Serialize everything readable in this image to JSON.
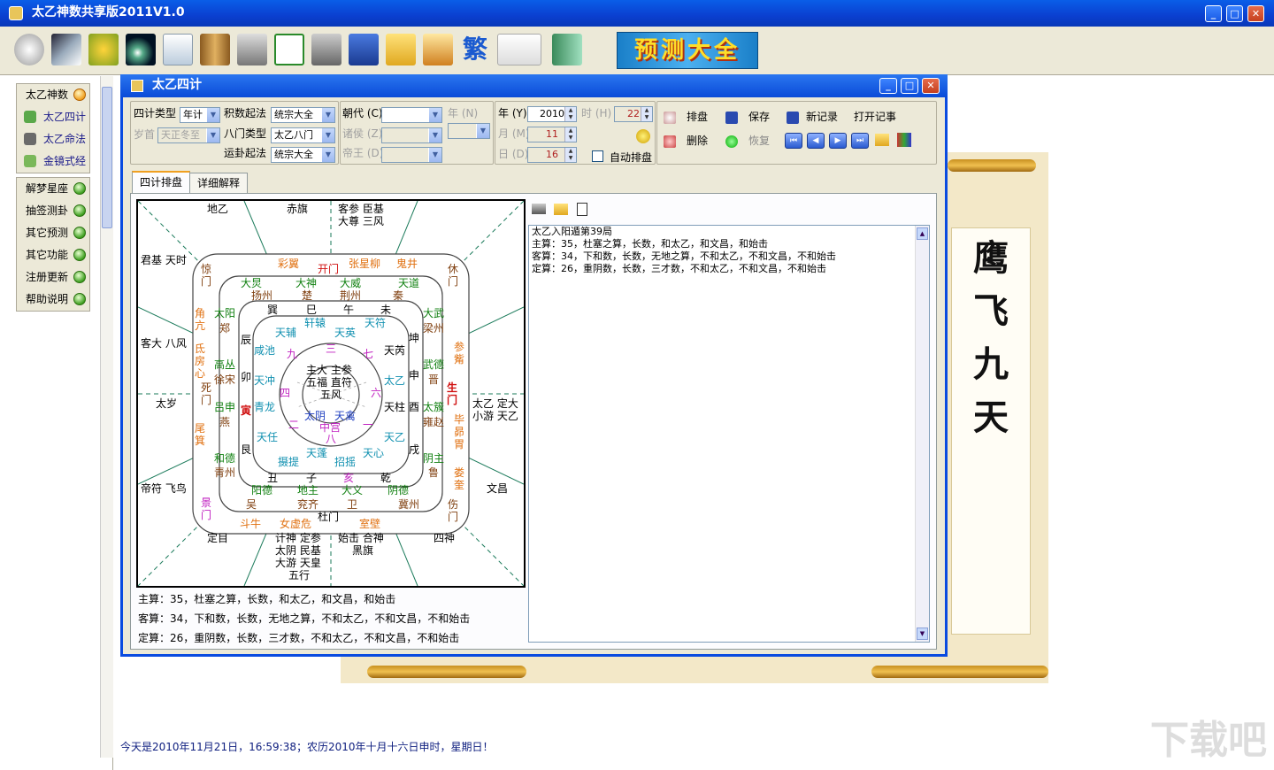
{
  "app": {
    "title": "太乙神数共享版2011V1.0"
  },
  "promo": {
    "label": "预测大全"
  },
  "sidebar": {
    "group1": [
      "太乙神数",
      "太乙四计",
      "太乙命法",
      "金镜式经"
    ],
    "group2": [
      "解梦星座",
      "抽签测卦",
      "其它预测",
      "其它功能",
      "注册更新",
      "帮助说明"
    ]
  },
  "dialog": {
    "title": "太乙四计",
    "fields": {
      "siji_type_label": "四计类型",
      "siji_type_value": "年计",
      "jishu_label": "积数起法",
      "jishu_value": "统宗大全",
      "suishou_label": "岁首",
      "suishou_value": "天正冬至",
      "bamen_label": "八门类型",
      "bamen_value": "太乙八门",
      "yungua_label": "运卦起法",
      "yungua_value": "统宗大全",
      "chaodai_label": "朝代 (C)",
      "zhuhou_label": "诸侯 (Z)",
      "diwang_label": "帝王 (D)",
      "nian_n_label": "年 (N)",
      "year_label": "年 (Y)",
      "year_value": "2010",
      "month_label": "月 (M)",
      "month_value": "11",
      "day_label": "日 (D)",
      "day_value": "16",
      "hour_label": "时 (H)",
      "hour_value": "22",
      "auto_label": "自动排盘"
    },
    "actions": {
      "paipan": "排盘",
      "save": "保存",
      "new_record": "新记录",
      "open_notes": "打开记事",
      "delete": "删除",
      "restore": "恢复"
    },
    "tabs": [
      "四计排盘",
      "详细解释"
    ],
    "calc_lines": [
      "主算：35，杜塞之算，长数，和太乙，和文昌，和始击",
      "客算：34，下和数，长数，无地之算，不和太乙，不和文昌，不和始击",
      "定算：26，重阴数，长数，三才数，不和太乙，不和文昌，不和始击"
    ],
    "result_lines": [
      "太乙入阳遁第39局",
      "主算：35，杜塞之算，长数，和太乙，和文昌，和始击",
      "客算：34，下和数，长数，无地之算，不和太乙，不和文昌，不和始击",
      "定算：26，重阴数，长数，三才数，不和太乙，不和文昌，不和始击"
    ]
  },
  "board": {
    "outer": {
      "top": [
        "地乙",
        "赤旗",
        "客参 臣基",
        "大尊 三风"
      ],
      "left": [
        "君基 天时",
        "客大 八风",
        "太岁",
        "帝符 飞鸟"
      ],
      "right": [
        "太乙 定大",
        "小游 天乙",
        "文昌"
      ],
      "bottom": [
        "定目",
        "计神 定参",
        "太阴 民基",
        "大游 天皇",
        "五行",
        "始击 合神",
        "黑旗",
        "四神"
      ]
    },
    "ring1": [
      "彩翼",
      "开门",
      "张星柳",
      "鬼井",
      "休门",
      "参觜",
      "生门",
      "毕昴胃",
      "娄奎",
      "伤门",
      "室壁",
      "女虚危",
      "斗牛",
      "杜门",
      "景门",
      "尾箕",
      "死门",
      "氐房心",
      "角亢",
      "惊门"
    ],
    "ring2": [
      "大炅",
      "扬州",
      "大神",
      "楚",
      "大威",
      "荆州",
      "天道",
      "秦",
      "大武",
      "梁州",
      "武德",
      "晋",
      "太簇",
      "雍赵",
      "阴主",
      "鲁",
      "阴德",
      "冀州",
      "大义",
      "卫",
      "地主",
      "兖齐",
      "阳德",
      "吴",
      "和德",
      "青州",
      "吕申",
      "燕",
      "高丛",
      "徐宋",
      "太阳",
      "郑"
    ],
    "ring3": [
      "巽",
      "巳",
      "午",
      "未",
      "坤",
      "申",
      "酉",
      "戌",
      "乾",
      "亥",
      "子",
      "丑",
      "艮",
      "寅",
      "卯",
      "辰"
    ],
    "ring4": [
      "轩辕",
      "天符",
      "天英",
      "天辅",
      "咸池",
      "天冲",
      "青龙",
      "天任",
      "摄提",
      "天蓬",
      "招摇",
      "天心",
      "天乙",
      "太乙",
      "天柱",
      "天芮"
    ],
    "inner": [
      "九",
      "三",
      "七",
      "四",
      "六",
      "二",
      "八",
      "一",
      "太阴",
      "天禽"
    ],
    "center": [
      "主大 主参",
      "五福 直符",
      "五风",
      "中宫"
    ]
  },
  "status": "今天是2010年11月21日，16:59:38；农历2010年十月十六日申时，星期日！",
  "scroll": {
    "calligraphy": "鹰飞九天"
  },
  "colors": {
    "title_blue": "#0a4be0",
    "panel": "#ece9d8",
    "red": "#d01010",
    "orange": "#e07010",
    "green": "#108010",
    "blue": "#2040c0",
    "cyan": "#1090b0",
    "brown": "#804010"
  }
}
